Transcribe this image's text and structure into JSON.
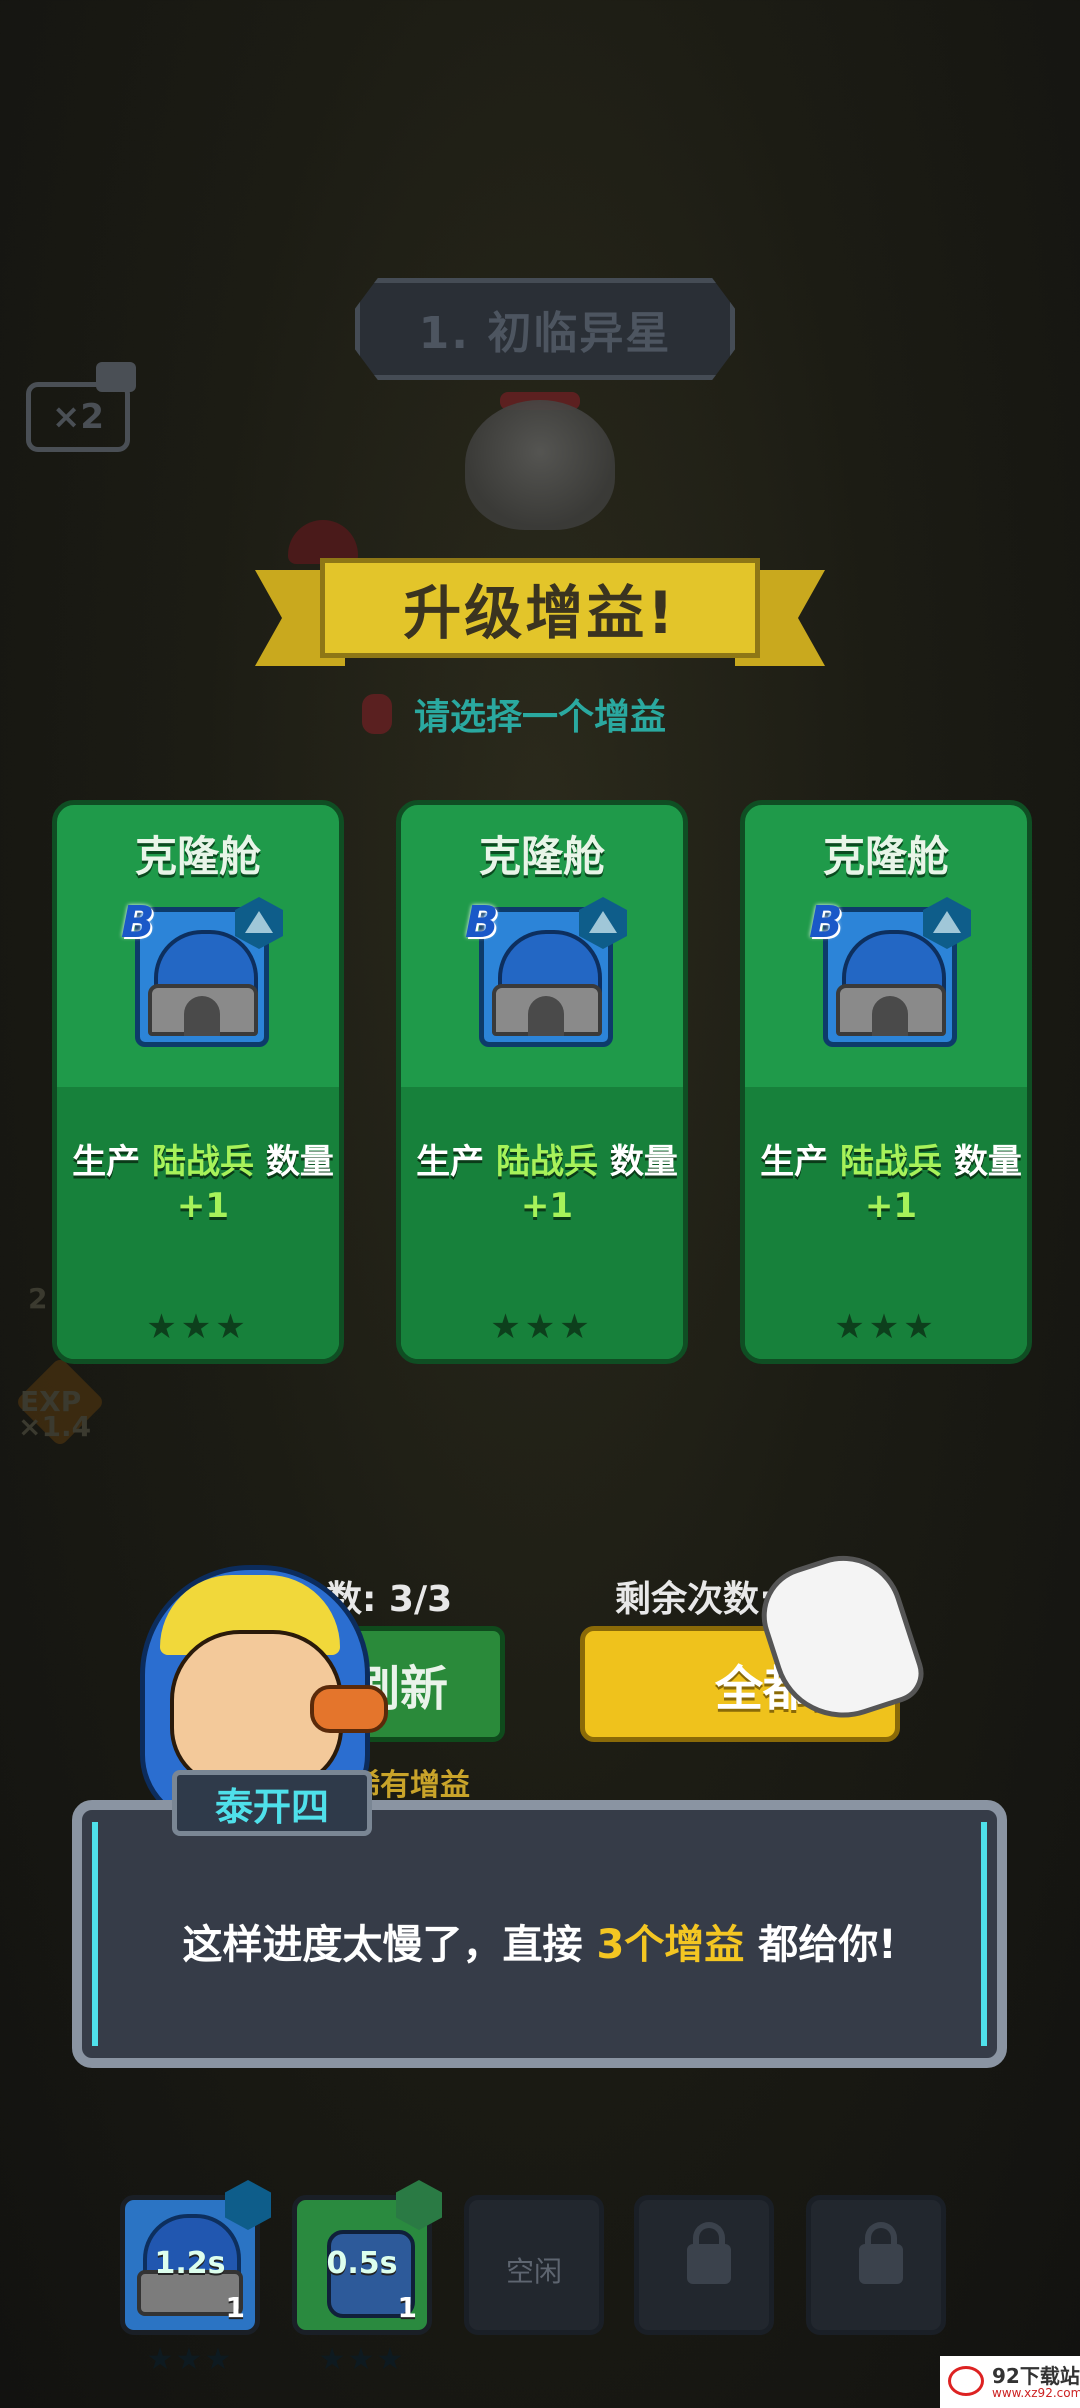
{
  "stage": {
    "title": "1. 初临异星",
    "speed_multiplier": "×2"
  },
  "reward": {
    "banner_title": "升级增益!",
    "subtitle": "请选择一个增益",
    "cards": [
      {
        "name": "克隆舱",
        "grade": "B",
        "desc_prefix": "生产 ",
        "desc_highlight": "陆战兵",
        "desc_mid": " 数量",
        "desc_bonus": "+1",
        "stars": "★★★"
      },
      {
        "name": "克隆舱",
        "grade": "B",
        "desc_prefix": "生产 ",
        "desc_highlight": "陆战兵",
        "desc_mid": " 数量",
        "desc_bonus": "+1",
        "stars": "★★★"
      },
      {
        "name": "克隆舱",
        "grade": "B",
        "desc_prefix": "生产 ",
        "desc_highlight": "陆战兵",
        "desc_mid": " 数量",
        "desc_bonus": "+1",
        "stars": "★★★"
      }
    ],
    "refresh_count_label": "次数: 3/3",
    "remaining_count_label": "剩余次数:",
    "refresh_button": "刷新",
    "take_all_button": "全都要",
    "rare_hint": "稀有增益"
  },
  "side_hud": {
    "exp_label": "EXP",
    "exp_multiplier": "×1.4",
    "side_number": "2"
  },
  "dialog": {
    "speaker": "泰开四",
    "text_before": "这样进度太慢了，直接 ",
    "text_highlight": "3个增益",
    "text_after": " 都给你!"
  },
  "slots": [
    {
      "label": "1.2s",
      "count": "1",
      "stars": "★★★",
      "state": "clone-pod"
    },
    {
      "label": "0.5s",
      "count": "1",
      "stars": "★★★",
      "state": "tower"
    },
    {
      "label": "空闲",
      "state": "idle"
    },
    {
      "state": "locked"
    },
    {
      "state": "locked"
    }
  ],
  "watermark": {
    "title": "92下载站",
    "sub": "www.xz92.com"
  },
  "colors": {
    "card_green": "#1f9a4a",
    "highlight_green": "#a7f25a",
    "dialog_highlight": "#f4c622",
    "speaker_cyan": "#4fe0ea",
    "gold": "#efc21c"
  }
}
